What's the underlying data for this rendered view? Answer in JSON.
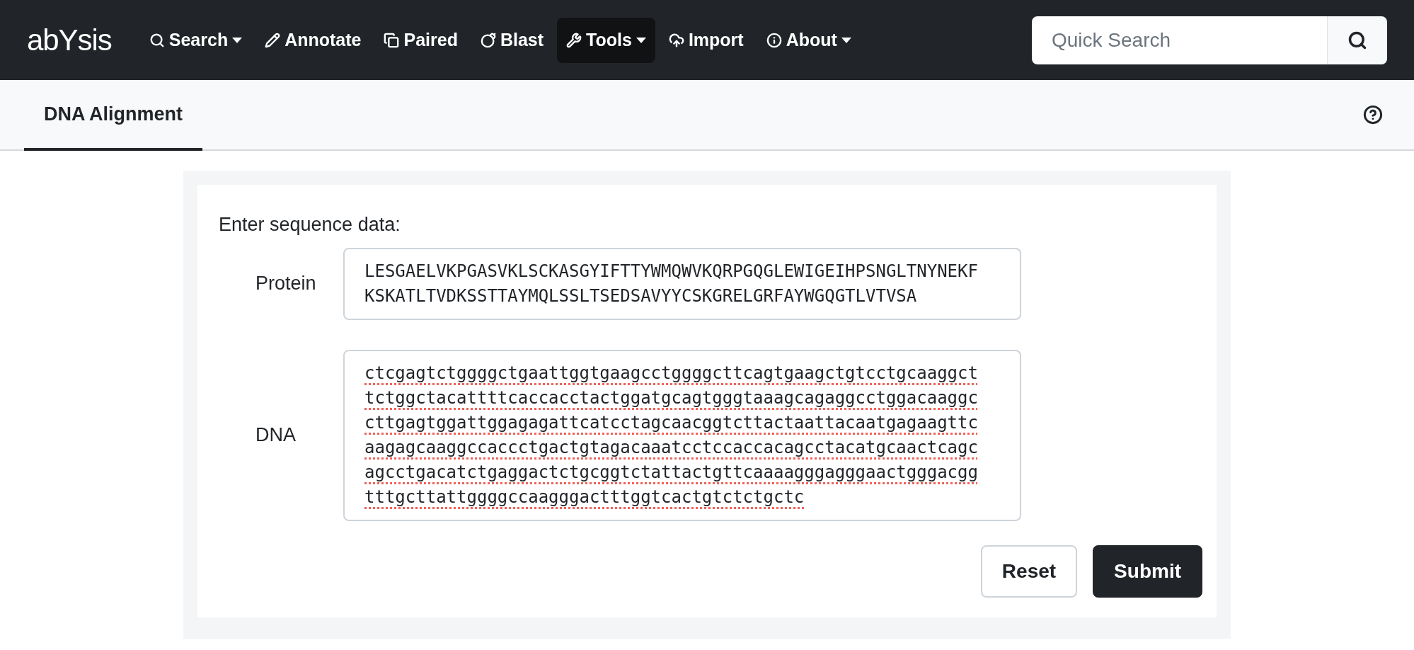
{
  "navbar": {
    "logo": "abYsis",
    "items": [
      {
        "label": "Search",
        "dropdown": true,
        "selected": false
      },
      {
        "label": "Annotate",
        "dropdown": false,
        "selected": false
      },
      {
        "label": "Paired",
        "dropdown": false,
        "selected": false
      },
      {
        "label": "Blast",
        "dropdown": false,
        "selected": false
      },
      {
        "label": "Tools",
        "dropdown": true,
        "selected": true
      },
      {
        "label": "Import",
        "dropdown": false,
        "selected": false
      },
      {
        "label": "About",
        "dropdown": true,
        "selected": false
      }
    ],
    "search": {
      "placeholder": "Quick Search"
    }
  },
  "tabs": [
    {
      "label": "DNA Alignment",
      "selected": true
    }
  ],
  "form": {
    "prompt": "Enter sequence data:",
    "fields": [
      {
        "label": "Protein",
        "value": "LESGAELVKPGASVKLSCKASGYIFTTYWMQWVKQRPGQGLEWIGEIHPSNGLTNYNEKFKSKATLTVDKSSTTAYMQLSSLTSEDSAVYYCSKGRELGRFAYWGQGTLVTVSA",
        "spellcheck_flagged": false
      },
      {
        "label": "DNA",
        "value": "ctcgagtctggggctgaattggtgaagcctggggcttcagtgaagctgtcctgcaaggcttctggctacattttcaccacctactggatgcagtgggtaaagcagaggcctggacaaggccttgagtggattggagagattcatcctagcaacggtcttactaattacaatgagaagttcaagagcaaggccaccctgactgtagacaaatcctccaccacagcctacatgcaactcagcagcctgacatctgaggactctgcggtctattactgttcaaaagggagggaactgggacggtttgcttattggggccaagggactttggtcactgtctctgctc",
        "spellcheck_flagged": true
      }
    ],
    "buttons": [
      {
        "label": "Reset",
        "kind": "secondary"
      },
      {
        "label": "Submit",
        "kind": "primary"
      }
    ]
  }
}
